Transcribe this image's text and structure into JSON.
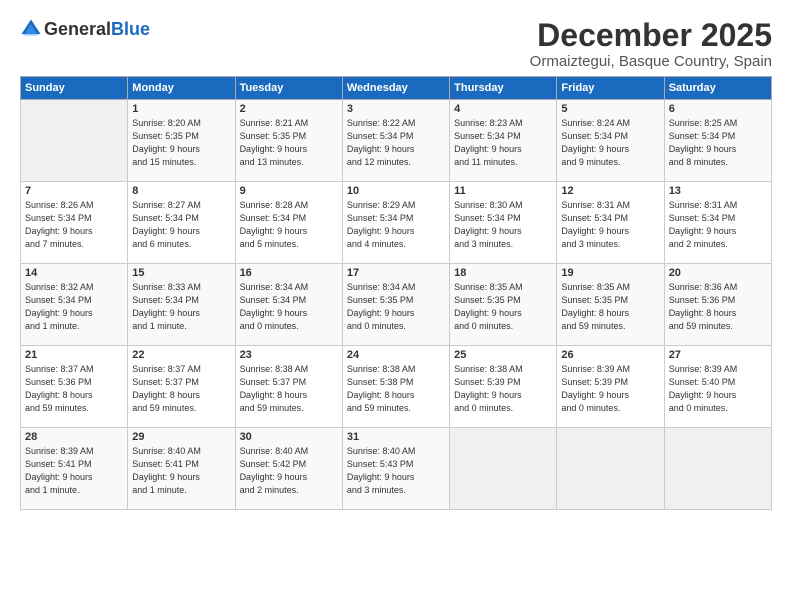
{
  "logo": {
    "general": "General",
    "blue": "Blue"
  },
  "title": "December 2025",
  "location": "Ormaiztegui, Basque Country, Spain",
  "weekdays": [
    "Sunday",
    "Monday",
    "Tuesday",
    "Wednesday",
    "Thursday",
    "Friday",
    "Saturday"
  ],
  "weeks": [
    [
      {
        "day": "",
        "info": ""
      },
      {
        "day": "1",
        "info": "Sunrise: 8:20 AM\nSunset: 5:35 PM\nDaylight: 9 hours\nand 15 minutes."
      },
      {
        "day": "2",
        "info": "Sunrise: 8:21 AM\nSunset: 5:35 PM\nDaylight: 9 hours\nand 13 minutes."
      },
      {
        "day": "3",
        "info": "Sunrise: 8:22 AM\nSunset: 5:34 PM\nDaylight: 9 hours\nand 12 minutes."
      },
      {
        "day": "4",
        "info": "Sunrise: 8:23 AM\nSunset: 5:34 PM\nDaylight: 9 hours\nand 11 minutes."
      },
      {
        "day": "5",
        "info": "Sunrise: 8:24 AM\nSunset: 5:34 PM\nDaylight: 9 hours\nand 9 minutes."
      },
      {
        "day": "6",
        "info": "Sunrise: 8:25 AM\nSunset: 5:34 PM\nDaylight: 9 hours\nand 8 minutes."
      }
    ],
    [
      {
        "day": "7",
        "info": "Sunrise: 8:26 AM\nSunset: 5:34 PM\nDaylight: 9 hours\nand 7 minutes."
      },
      {
        "day": "8",
        "info": "Sunrise: 8:27 AM\nSunset: 5:34 PM\nDaylight: 9 hours\nand 6 minutes."
      },
      {
        "day": "9",
        "info": "Sunrise: 8:28 AM\nSunset: 5:34 PM\nDaylight: 9 hours\nand 5 minutes."
      },
      {
        "day": "10",
        "info": "Sunrise: 8:29 AM\nSunset: 5:34 PM\nDaylight: 9 hours\nand 4 minutes."
      },
      {
        "day": "11",
        "info": "Sunrise: 8:30 AM\nSunset: 5:34 PM\nDaylight: 9 hours\nand 3 minutes."
      },
      {
        "day": "12",
        "info": "Sunrise: 8:31 AM\nSunset: 5:34 PM\nDaylight: 9 hours\nand 3 minutes."
      },
      {
        "day": "13",
        "info": "Sunrise: 8:31 AM\nSunset: 5:34 PM\nDaylight: 9 hours\nand 2 minutes."
      }
    ],
    [
      {
        "day": "14",
        "info": "Sunrise: 8:32 AM\nSunset: 5:34 PM\nDaylight: 9 hours\nand 1 minute."
      },
      {
        "day": "15",
        "info": "Sunrise: 8:33 AM\nSunset: 5:34 PM\nDaylight: 9 hours\nand 1 minute."
      },
      {
        "day": "16",
        "info": "Sunrise: 8:34 AM\nSunset: 5:34 PM\nDaylight: 9 hours\nand 0 minutes."
      },
      {
        "day": "17",
        "info": "Sunrise: 8:34 AM\nSunset: 5:35 PM\nDaylight: 9 hours\nand 0 minutes."
      },
      {
        "day": "18",
        "info": "Sunrise: 8:35 AM\nSunset: 5:35 PM\nDaylight: 9 hours\nand 0 minutes."
      },
      {
        "day": "19",
        "info": "Sunrise: 8:35 AM\nSunset: 5:35 PM\nDaylight: 8 hours\nand 59 minutes."
      },
      {
        "day": "20",
        "info": "Sunrise: 8:36 AM\nSunset: 5:36 PM\nDaylight: 8 hours\nand 59 minutes."
      }
    ],
    [
      {
        "day": "21",
        "info": "Sunrise: 8:37 AM\nSunset: 5:36 PM\nDaylight: 8 hours\nand 59 minutes."
      },
      {
        "day": "22",
        "info": "Sunrise: 8:37 AM\nSunset: 5:37 PM\nDaylight: 8 hours\nand 59 minutes."
      },
      {
        "day": "23",
        "info": "Sunrise: 8:38 AM\nSunset: 5:37 PM\nDaylight: 8 hours\nand 59 minutes."
      },
      {
        "day": "24",
        "info": "Sunrise: 8:38 AM\nSunset: 5:38 PM\nDaylight: 8 hours\nand 59 minutes."
      },
      {
        "day": "25",
        "info": "Sunrise: 8:38 AM\nSunset: 5:39 PM\nDaylight: 9 hours\nand 0 minutes."
      },
      {
        "day": "26",
        "info": "Sunrise: 8:39 AM\nSunset: 5:39 PM\nDaylight: 9 hours\nand 0 minutes."
      },
      {
        "day": "27",
        "info": "Sunrise: 8:39 AM\nSunset: 5:40 PM\nDaylight: 9 hours\nand 0 minutes."
      }
    ],
    [
      {
        "day": "28",
        "info": "Sunrise: 8:39 AM\nSunset: 5:41 PM\nDaylight: 9 hours\nand 1 minute."
      },
      {
        "day": "29",
        "info": "Sunrise: 8:40 AM\nSunset: 5:41 PM\nDaylight: 9 hours\nand 1 minute."
      },
      {
        "day": "30",
        "info": "Sunrise: 8:40 AM\nSunset: 5:42 PM\nDaylight: 9 hours\nand 2 minutes."
      },
      {
        "day": "31",
        "info": "Sunrise: 8:40 AM\nSunset: 5:43 PM\nDaylight: 9 hours\nand 3 minutes."
      },
      {
        "day": "",
        "info": ""
      },
      {
        "day": "",
        "info": ""
      },
      {
        "day": "",
        "info": ""
      }
    ]
  ]
}
